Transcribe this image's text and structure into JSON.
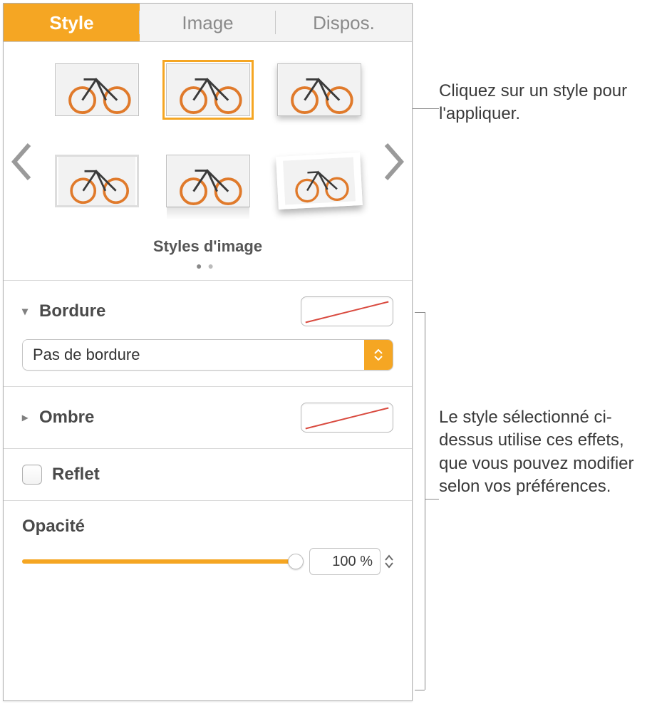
{
  "tabs": {
    "style": "Style",
    "image": "Image",
    "dispos": "Dispos."
  },
  "styles_section": {
    "title": "Styles d'image"
  },
  "border": {
    "label": "Bordure",
    "dropdown_value": "Pas de bordure"
  },
  "shadow": {
    "label": "Ombre"
  },
  "reflection": {
    "label": "Reflet",
    "checked": false
  },
  "opacity": {
    "label": "Opacité",
    "value": "100 %",
    "percent": 100
  },
  "callouts": {
    "apply": "Cliquez sur un style pour l'appliquer.",
    "effects": "Le style sélectionné ci-dessus utilise ces effets, que vous pouvez modifier selon vos préférences."
  }
}
